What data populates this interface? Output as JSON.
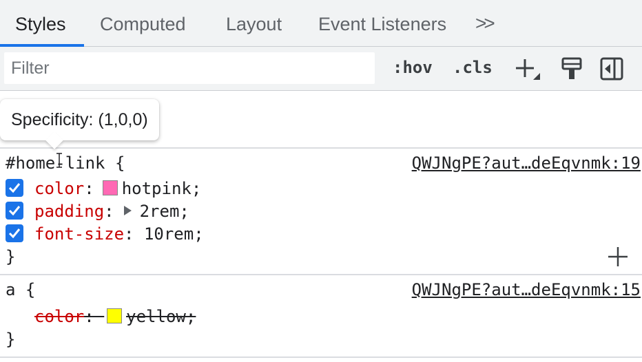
{
  "tabs": [
    {
      "label": "Styles",
      "active": true
    },
    {
      "label": "Computed",
      "active": false
    },
    {
      "label": "Layout",
      "active": false
    },
    {
      "label": "Event Listeners",
      "active": false
    }
  ],
  "tabs_more": ">>",
  "toolbar": {
    "filter_placeholder": "Filter",
    "hov_label": ":hov",
    "cls_label": ".cls",
    "icons": [
      "new-style-rule-icon",
      "paint-brush-icon",
      "toggle-sidebar-icon"
    ]
  },
  "tooltip": {
    "text": "Specificity: (1,0,0)"
  },
  "rules": [
    {
      "selector": "#home-link {",
      "source": "QWJNgPE?aut…deEqvnmk:19",
      "declarations": [
        {
          "property": "color",
          "value": "hotpink;",
          "swatch": "#ff69b4",
          "checked": true
        },
        {
          "property": "padding",
          "value": "2rem;",
          "expandable": true,
          "checked": true
        },
        {
          "property": "font-size",
          "value": "10rem;",
          "checked": true
        }
      ],
      "close": "}"
    },
    {
      "selector": "a {",
      "source": "QWJNgPE?aut…deEqvnmk:15",
      "declarations": [
        {
          "property": "color",
          "value": "yellow;",
          "swatch": "#ffff00",
          "overridden": true
        }
      ],
      "close": "}"
    }
  ],
  "colors": {
    "accent": "#1a73e8",
    "property": "#c80000"
  }
}
